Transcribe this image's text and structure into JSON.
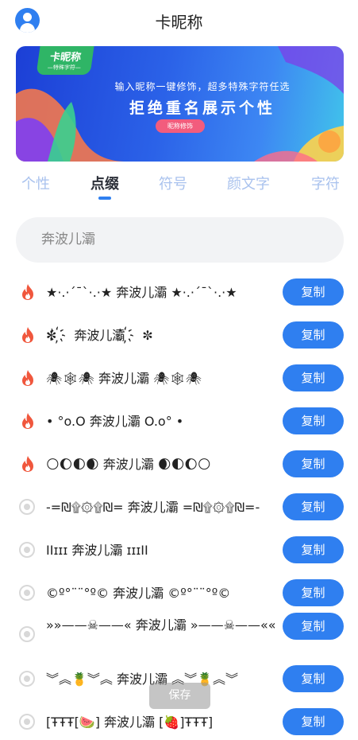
{
  "header": {
    "title": "卡昵称",
    "avatar_icon": "user-icon"
  },
  "banner": {
    "badge_title": "卡昵称",
    "badge_sub": "—特殊字符—",
    "subtitle": "输入昵称一键修饰，超多特殊字符任选",
    "headline": "拒绝重名展示个性",
    "button": "昵称修饰"
  },
  "tabs": [
    {
      "label": "个性",
      "active": false
    },
    {
      "label": "点缀",
      "active": true
    },
    {
      "label": "符号",
      "active": false
    },
    {
      "label": "颜文字",
      "active": false
    },
    {
      "label": "字符",
      "active": false
    }
  ],
  "search": {
    "value": "奔波儿灞"
  },
  "items": [
    {
      "text": "★·.·´¯`·.·★ 奔波儿灞 ★·.·´¯`·.·★",
      "icon": "fire-icon",
      "button": "复制"
    },
    {
      "text": "✼ ҉  奔波儿灞 ҉  ✼",
      "icon": "fire-icon",
      "button": "复制"
    },
    {
      "text": "🕷🕸🕷 奔波儿灞 🕷🕸🕷",
      "icon": "fire-icon",
      "button": "复制"
    },
    {
      "text": "• °o.O 奔波儿灞 O.o° •",
      "icon": "fire-icon",
      "button": "复制"
    },
    {
      "text": "🌕🌔🌓🌒 奔波儿灞 🌒🌓🌔🌕",
      "icon": "fire-icon",
      "button": "复制"
    },
    {
      "text": "-=₪۩۞۩₪= 奔波儿灞 =₪۩۞۩₪=-",
      "icon": "radio-icon",
      "button": "复制"
    },
    {
      "text": "ΙΙɪɪɪ 奔波儿灞 ɪɪɪΙΙ",
      "icon": "radio-icon",
      "button": "复制"
    },
    {
      "text": "©º°¨¨°º© 奔波儿灞 ©º°¨¨°º©",
      "icon": "radio-icon",
      "button": "复制"
    },
    {
      "text": "»»——☠——« 奔波儿灞 »——☠——««",
      "icon": "radio-icon",
      "button": "复制"
    },
    {
      "text": "︾︽🍍︾︽ 奔波儿灞 ︽︾🍍︽︾",
      "icon": "radio-icon",
      "button": "复制"
    },
    {
      "text": "[ŦŦŦ[🍉] 奔波儿灞 [🍓]ŦŦŦ]",
      "icon": "radio-icon",
      "button": "复制"
    }
  ],
  "toast": {
    "label": "保存"
  },
  "colors": {
    "accent": "#2f7ff0",
    "fire": "#f0573d",
    "tab_inactive": "#a9c2ee"
  }
}
